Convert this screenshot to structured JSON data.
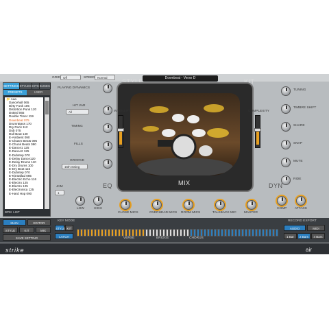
{
  "tabs": [
    "SETTINGS",
    "STYLES",
    "KITS",
    "BUSES"
  ],
  "subtabs": [
    "PRESETS",
    "USER"
  ],
  "styles_root": "Aaa",
  "styles": [
    "Dancehall 065",
    "Dirty Funk 105",
    "Distortion Punk 120",
    "Dotted 065",
    "Double Timer 119",
    "Downbeat 075",
    "DrumnBass 170",
    "Dry Rock 112",
    "Dub 075",
    "Dull Beat 140",
    "E-Ambient 090",
    "E-Chasm Beats 095",
    "E-Chunk Beats 090",
    "E-Dance1 125",
    "E-Dance2 125",
    "E-Dubstep 070",
    "E-Delay Dance120",
    "E-Delay Drums 110",
    "E-Dry Drums 100",
    "E-Dry Beat 115",
    "E-Dubstep 070",
    "E-Kit Ballad 085",
    "E-Electric Echo 116",
    "E-Electro 125",
    "E-Electro 125",
    "E-Electronica 125",
    "E-Hard Hop 090"
  ],
  "selected_style": "Downbeat 075",
  "bpm_label": "BPM",
  "list_label": "LIST",
  "top": {
    "grid_label": "GRID",
    "grid": "Off",
    "speed_label": "SPEED",
    "speed": "Normal"
  },
  "preset_title": "Downbeat - Verse D",
  "labels": {
    "style": "STYLE",
    "kit": "KIT",
    "mix": "MIX",
    "eq": "EQ",
    "dyn": "DYN",
    "intensity": "INTENSITY",
    "complexity": "COMPLEXITY"
  },
  "left_controls": {
    "playing_dynamics": "PLAYING DYNAMICS",
    "hit_var": "HIT VAR",
    "all": "All",
    "timing": "TIMING",
    "fills": "FILLS",
    "groove": "GROOVE",
    "groove_val": "16th Swing",
    "jam": "JAM"
  },
  "right_controls": [
    "TUNING",
    "TIMBRE SHIFT",
    "SHARE",
    "SNAP",
    "MUTE",
    "RIDE"
  ],
  "mix_knobs": [
    "CLOSE MICS",
    "OVERHEAD MICS",
    "ROOM MICS",
    "TALKBACK MIC",
    "MASTER"
  ],
  "eq_knobs": [
    "LOW",
    "HIGH"
  ],
  "dyn_knobs": [
    "COMP",
    "ATTACK"
  ],
  "bottom": {
    "main": "MAIN",
    "editor": "EDITOR",
    "style": "STYLE",
    "kit": "KIT",
    "mix": "MIX",
    "save": "SAVE SETTING",
    "style2": "STYLE",
    "kit2": "KIT",
    "latch": "LATCH",
    "key_mode": "KEY MODE",
    "verse": "VERSE",
    "bridge": "BRIDGE",
    "chorus": "CHORUS",
    "record": "RECORD EXPORT",
    "audio": "AUDIO",
    "midi": "MIDI",
    "bars": [
      "1 Bar",
      "2 Bars",
      "4 Bars"
    ]
  },
  "footer": {
    "logo": "strike",
    "brand": "air"
  },
  "colors": {
    "accent": "#e8a020",
    "blue": "#2b7fc0"
  }
}
